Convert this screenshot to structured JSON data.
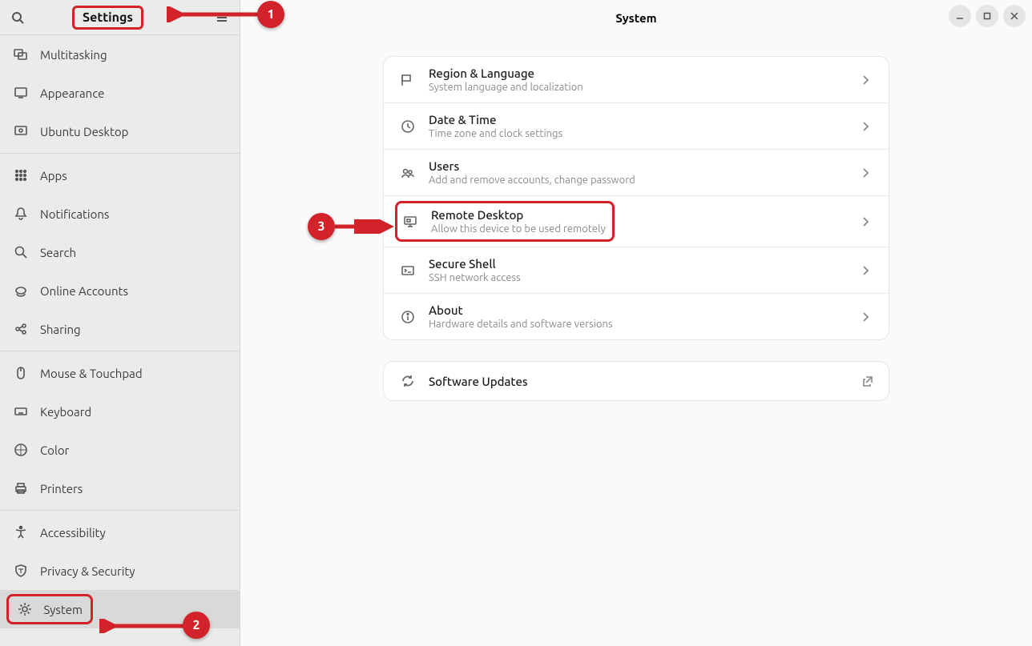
{
  "header": {
    "sidebar_title": "Settings",
    "main_title": "System"
  },
  "sidebar": {
    "groups": [
      [
        {
          "icon": "multitasking-icon",
          "label": "Multitasking"
        },
        {
          "icon": "appearance-icon",
          "label": "Appearance"
        },
        {
          "icon": "ubuntu-desktop-icon",
          "label": "Ubuntu Desktop"
        }
      ],
      [
        {
          "icon": "apps-icon",
          "label": "Apps"
        },
        {
          "icon": "notifications-icon",
          "label": "Notifications"
        },
        {
          "icon": "search-icon",
          "label": "Search"
        },
        {
          "icon": "online-accounts-icon",
          "label": "Online Accounts"
        },
        {
          "icon": "sharing-icon",
          "label": "Sharing"
        }
      ],
      [
        {
          "icon": "mouse-icon",
          "label": "Mouse & Touchpad"
        },
        {
          "icon": "keyboard-icon",
          "label": "Keyboard"
        },
        {
          "icon": "color-icon",
          "label": "Color"
        },
        {
          "icon": "printers-icon",
          "label": "Printers"
        }
      ],
      [
        {
          "icon": "accessibility-icon",
          "label": "Accessibility"
        },
        {
          "icon": "privacy-icon",
          "label": "Privacy & Security"
        },
        {
          "icon": "system-icon",
          "label": "System",
          "selected": true,
          "highlight": true
        }
      ]
    ]
  },
  "main": {
    "rows": [
      {
        "icon": "region-icon",
        "title": "Region & Language",
        "sub": "System language and localization"
      },
      {
        "icon": "datetime-icon",
        "title": "Date & Time",
        "sub": "Time zone and clock settings"
      },
      {
        "icon": "users-icon",
        "title": "Users",
        "sub": "Add and remove accounts, change password"
      },
      {
        "icon": "remote-desktop-icon",
        "title": "Remote Desktop",
        "sub": "Allow this device to be used remotely",
        "highlight": true
      },
      {
        "icon": "secure-shell-icon",
        "title": "Secure Shell",
        "sub": "SSH network access"
      },
      {
        "icon": "about-icon",
        "title": "About",
        "sub": "Hardware details and software versions"
      }
    ],
    "updates": {
      "icon": "updates-icon",
      "title": "Software Updates"
    }
  },
  "annotations": {
    "badge1": "1",
    "badge2": "2",
    "badge3": "3"
  }
}
